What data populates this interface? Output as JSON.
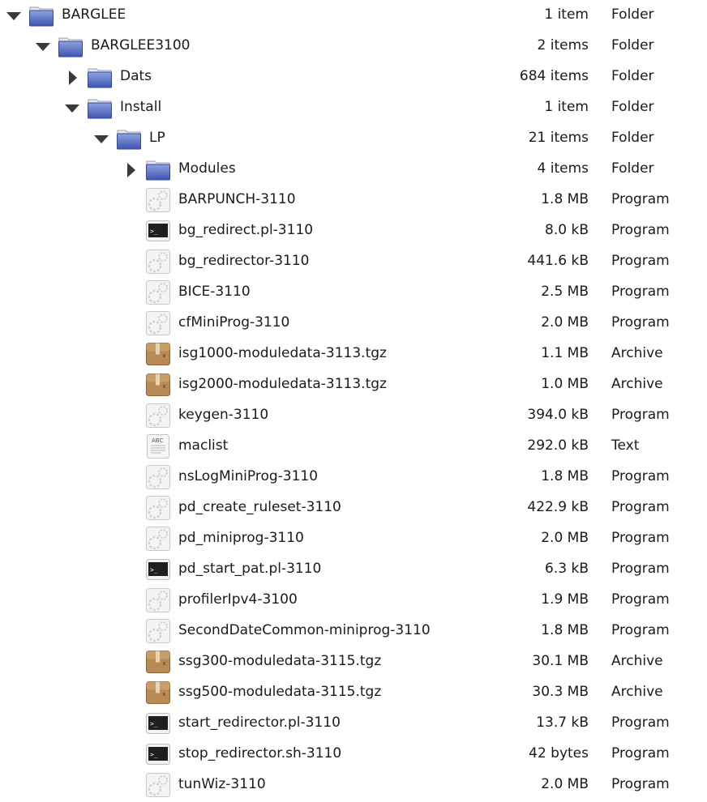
{
  "colors": {
    "folder": "#5a74c8",
    "archive": "#b98a55",
    "terminal": "#1e1e1e",
    "text": "#1a1a1a"
  },
  "rows": [
    {
      "name": "BARGLEE",
      "size": "1 item",
      "type": "Folder",
      "level": 0,
      "icon": "folder-icon",
      "expander": "open"
    },
    {
      "name": "BARGLEE3100",
      "size": "2 items",
      "type": "Folder",
      "level": 1,
      "icon": "folder-icon",
      "expander": "open"
    },
    {
      "name": "Dats",
      "size": "684 items",
      "type": "Folder",
      "level": 2,
      "icon": "folder-icon",
      "expander": "closed"
    },
    {
      "name": "Install",
      "size": "1 item",
      "type": "Folder",
      "level": 2,
      "icon": "folder-icon",
      "expander": "open"
    },
    {
      "name": "LP",
      "size": "21 items",
      "type": "Folder",
      "level": 3,
      "icon": "folder-icon",
      "expander": "open"
    },
    {
      "name": "Modules",
      "size": "4 items",
      "type": "Folder",
      "level": 4,
      "icon": "folder-icon",
      "expander": "closed"
    },
    {
      "name": "BARPUNCH-3110",
      "size": "1.8 MB",
      "type": "Program",
      "level": 4,
      "icon": "executable-icon"
    },
    {
      "name": "bg_redirect.pl-3110",
      "size": "8.0 kB",
      "type": "Program",
      "level": 4,
      "icon": "terminal-icon"
    },
    {
      "name": "bg_redirector-3110",
      "size": "441.6 kB",
      "type": "Program",
      "level": 4,
      "icon": "executable-icon"
    },
    {
      "name": "BICE-3110",
      "size": "2.5 MB",
      "type": "Program",
      "level": 4,
      "icon": "executable-icon"
    },
    {
      "name": "cfMiniProg-3110",
      "size": "2.0 MB",
      "type": "Program",
      "level": 4,
      "icon": "executable-icon"
    },
    {
      "name": "isg1000-moduledata-3113.tgz",
      "size": "1.1 MB",
      "type": "Archive",
      "level": 4,
      "icon": "archive-icon"
    },
    {
      "name": "isg2000-moduledata-3113.tgz",
      "size": "1.0 MB",
      "type": "Archive",
      "level": 4,
      "icon": "archive-icon"
    },
    {
      "name": "keygen-3110",
      "size": "394.0 kB",
      "type": "Program",
      "level": 4,
      "icon": "executable-icon"
    },
    {
      "name": "maclist",
      "size": "292.0 kB",
      "type": "Text",
      "level": 4,
      "icon": "text-file-icon"
    },
    {
      "name": "nsLogMiniProg-3110",
      "size": "1.8 MB",
      "type": "Program",
      "level": 4,
      "icon": "executable-icon"
    },
    {
      "name": "pd_create_ruleset-3110",
      "size": "422.9 kB",
      "type": "Program",
      "level": 4,
      "icon": "executable-icon"
    },
    {
      "name": "pd_miniprog-3110",
      "size": "2.0 MB",
      "type": "Program",
      "level": 4,
      "icon": "executable-icon"
    },
    {
      "name": "pd_start_pat.pl-3110",
      "size": "6.3 kB",
      "type": "Program",
      "level": 4,
      "icon": "terminal-icon"
    },
    {
      "name": "profilerIpv4-3100",
      "size": "1.9 MB",
      "type": "Program",
      "level": 4,
      "icon": "executable-icon"
    },
    {
      "name": "SecondDateCommon-miniprog-3110",
      "size": "1.8 MB",
      "type": "Program",
      "level": 4,
      "icon": "executable-icon"
    },
    {
      "name": "ssg300-moduledata-3115.tgz",
      "size": "30.1 MB",
      "type": "Archive",
      "level": 4,
      "icon": "archive-icon"
    },
    {
      "name": "ssg500-moduledata-3115.tgz",
      "size": "30.3 MB",
      "type": "Archive",
      "level": 4,
      "icon": "archive-icon"
    },
    {
      "name": "start_redirector.pl-3110",
      "size": "13.7 kB",
      "type": "Program",
      "level": 4,
      "icon": "terminal-icon"
    },
    {
      "name": "stop_redirector.sh-3110",
      "size": "42 bytes",
      "type": "Program",
      "level": 4,
      "icon": "terminal-icon"
    },
    {
      "name": "tunWiz-3110",
      "size": "2.0 MB",
      "type": "Program",
      "level": 4,
      "icon": "executable-icon"
    }
  ],
  "text_icon_label": "ABC",
  "terminal_prompt": ">_"
}
